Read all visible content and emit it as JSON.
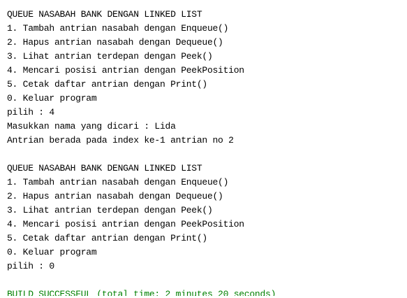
{
  "output": {
    "lines": [
      {
        "text": "QUEUE NASABAH BANK DENGAN LINKED LIST",
        "type": "normal"
      },
      {
        "text": "1. Tambah antrian nasabah dengan Enqueue()",
        "type": "normal"
      },
      {
        "text": "2. Hapus antrian nasabah dengan Dequeue()",
        "type": "normal"
      },
      {
        "text": "3. Lihat antrian terdepan dengan Peek()",
        "type": "normal"
      },
      {
        "text": "4. Mencari posisi antrian dengan PeekPosition",
        "type": "normal"
      },
      {
        "text": "5. Cetak daftar antrian dengan Print()",
        "type": "normal"
      },
      {
        "text": "0. Keluar program",
        "type": "normal"
      },
      {
        "text": "pilih : 4",
        "type": "normal"
      },
      {
        "text": "Masukkan nama yang dicari : Lida",
        "type": "normal"
      },
      {
        "text": "Antrian berada pada index ke-1 antrian no 2",
        "type": "normal"
      },
      {
        "text": "",
        "type": "blank"
      },
      {
        "text": "QUEUE NASABAH BANK DENGAN LINKED LIST",
        "type": "normal"
      },
      {
        "text": "1. Tambah antrian nasabah dengan Enqueue()",
        "type": "normal"
      },
      {
        "text": "2. Hapus antrian nasabah dengan Dequeue()",
        "type": "normal"
      },
      {
        "text": "3. Lihat antrian terdepan dengan Peek()",
        "type": "normal"
      },
      {
        "text": "4. Mencari posisi antrian dengan PeekPosition",
        "type": "normal"
      },
      {
        "text": "5. Cetak daftar antrian dengan Print()",
        "type": "normal"
      },
      {
        "text": "0. Keluar program",
        "type": "normal"
      },
      {
        "text": "pilih : 0",
        "type": "normal"
      },
      {
        "text": "",
        "type": "blank"
      },
      {
        "text": "BUILD SUCCESSFUL (total time: 2 minutes 20 seconds)",
        "type": "success"
      }
    ],
    "colors": {
      "text": "#000000",
      "success": "#008000",
      "background": "#ffffff"
    }
  }
}
